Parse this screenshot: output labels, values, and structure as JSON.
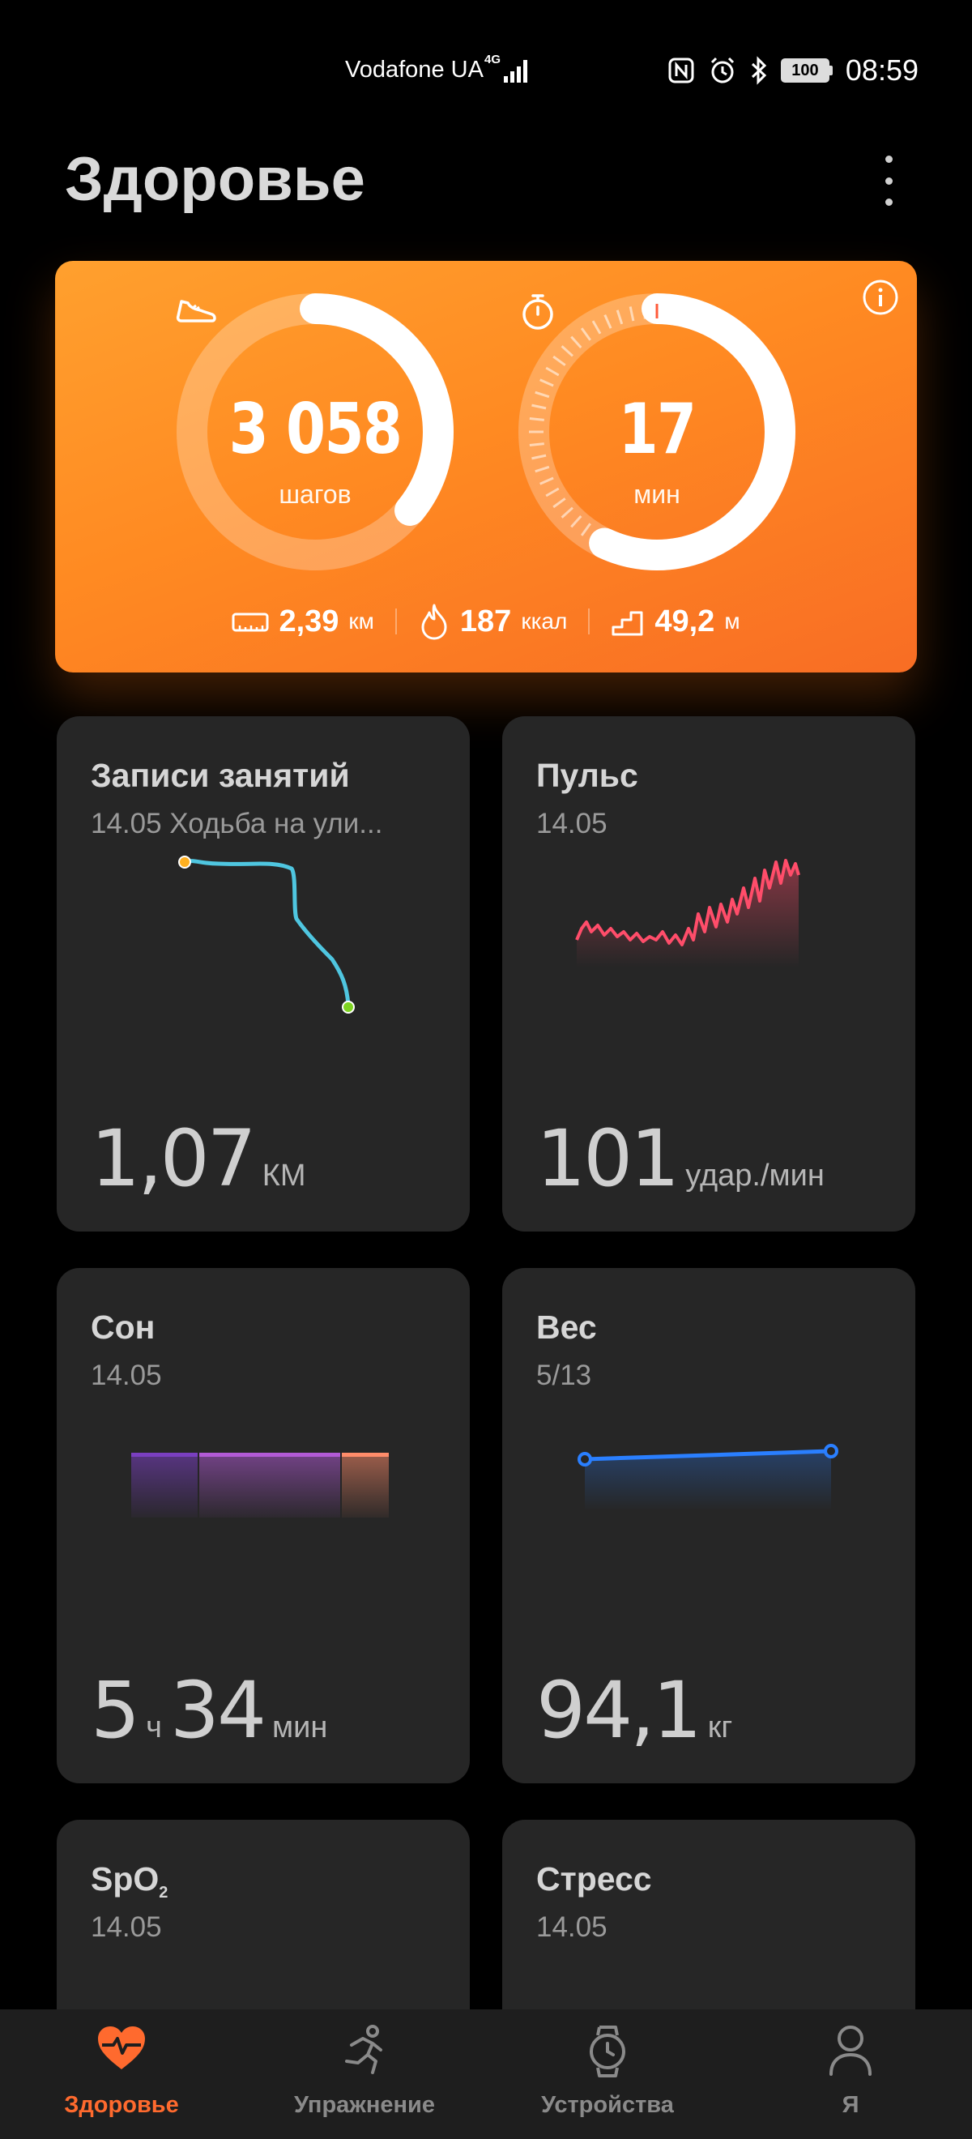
{
  "status_bar": {
    "carrier": "Vodafone UA",
    "network": "4G",
    "battery": "100",
    "time": "08:59"
  },
  "header": {
    "title": "Здоровье"
  },
  "activity": {
    "steps_value": "3 058",
    "steps_unit": "шагов",
    "steps_progress": 0.36,
    "minutes_value": "17",
    "minutes_unit": "мин",
    "minutes_progress": 0.57,
    "distance_value": "2,39",
    "distance_unit": "км",
    "calories_value": "187",
    "calories_unit": "ккал",
    "floors_value": "49,2",
    "floors_unit": "м"
  },
  "cards": {
    "workouts": {
      "title": "Записи занятий",
      "subtitle": "14.05 Ходьба на ули...",
      "value": "1,07",
      "unit": "КМ"
    },
    "pulse": {
      "title": "Пульс",
      "subtitle": "14.05",
      "value": "101",
      "unit": "удар./мин"
    },
    "sleep": {
      "title": "Сон",
      "subtitle": "14.05",
      "hours": "5",
      "hours_unit": "ч",
      "minutes": "34",
      "minutes_unit": "мин"
    },
    "weight": {
      "title": "Вес",
      "subtitle": "5/13",
      "value": "94,1",
      "unit": "кг"
    },
    "spo2": {
      "title": "SpO",
      "title_sub": "2",
      "subtitle": "14.05"
    },
    "stress": {
      "title": "Стресс",
      "subtitle": "14.05"
    }
  },
  "colors": {
    "accent": "#ff6a2e",
    "route": "#4fc6e0",
    "pulse": "#ff4d6a",
    "weight": "#2a7fff",
    "sleep_deep": "#7a3fc0",
    "sleep_light": "#b25ad6",
    "sleep_rem": "#ff8c6a"
  },
  "nav": {
    "items": [
      {
        "label": "Здоровье",
        "icon": "heart-pulse-icon",
        "active": true
      },
      {
        "label": "Упражнение",
        "icon": "running-icon",
        "active": false
      },
      {
        "label": "Устройства",
        "icon": "watch-icon",
        "active": false
      },
      {
        "label": "Я",
        "icon": "person-icon",
        "active": false
      }
    ]
  }
}
